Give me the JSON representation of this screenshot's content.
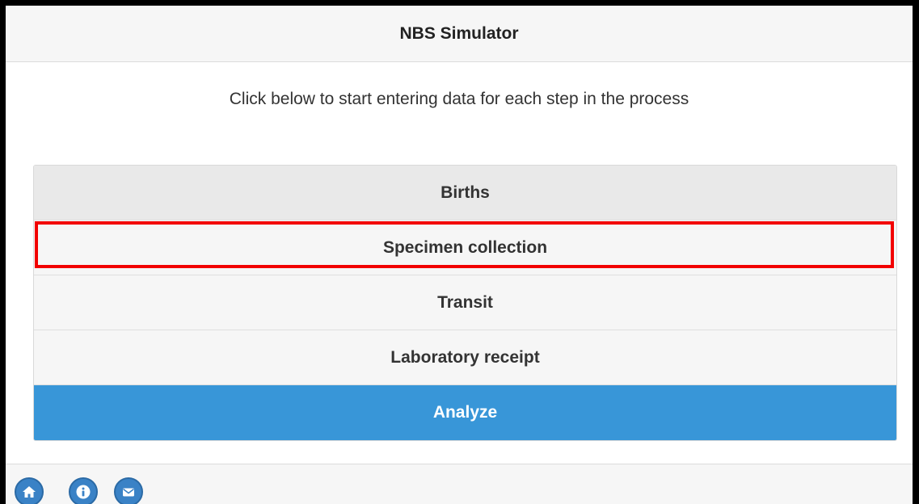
{
  "header": {
    "title": "NBS Simulator"
  },
  "instructions": "Click below to start entering data for each step in the process",
  "menu": {
    "items": [
      {
        "label": "Births"
      },
      {
        "label": "Specimen collection"
      },
      {
        "label": "Transit"
      },
      {
        "label": "Laboratory receipt"
      },
      {
        "label": "Analyze"
      }
    ]
  },
  "footer": {
    "buttons": [
      {
        "icon": "home-icon"
      },
      {
        "icon": "info-icon"
      },
      {
        "icon": "mail-icon"
      }
    ]
  },
  "colors": {
    "accent": "#3896d8",
    "highlight": "#f20000",
    "footer_button": "#3a82c6"
  }
}
